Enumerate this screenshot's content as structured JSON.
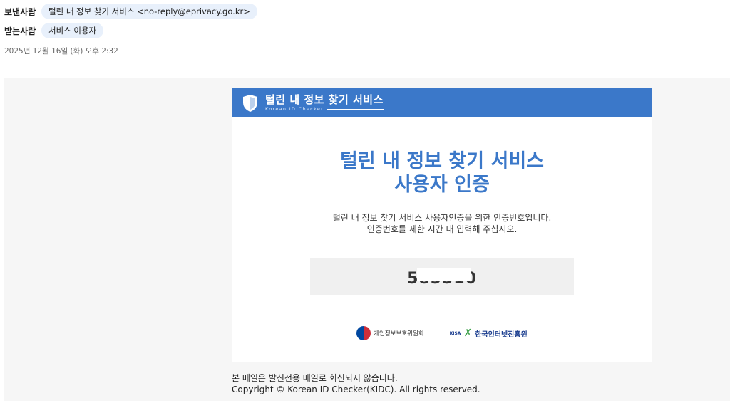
{
  "header": {
    "sender_label": "보낸사람",
    "sender_value": "털린 내 정보 찾기 서비스 <no-reply@eprivacy.go.kr>",
    "recipient_label": "받는사람",
    "recipient_value": "서비스 이용자",
    "date": "2025년 12월 16일 (화) 오후 2:32"
  },
  "email": {
    "brand_title": "털린 내 정보 찾기 서비스",
    "brand_subtitle": "Korean ID Checker",
    "title_line1": "털린 내 정보 찾기 서비스",
    "title_line2": "사용자 인증",
    "desc_line1": "털린 내 정보 찾기 서비스 사용자인증을 위한 인증번호입니다.",
    "desc_line2": "인증번호를 제한 시간 내 입력해 주십시오.",
    "code_label": "인증번호",
    "code_value": "585510",
    "logo1": "개인정보보호위원회",
    "logo2_small": "KISA",
    "logo2": "한국인터넷진흥원"
  },
  "footer": {
    "line1": "본 메일은 발신전용 메일로 회신되지 않습니다.",
    "line2": "Copyright © Korean ID Checker(KIDC). All rights reserved."
  },
  "colors": {
    "brand_blue": "#3b78c9",
    "chip_bg": "#e8f0fb",
    "mail_bg": "#f6f6f6"
  }
}
